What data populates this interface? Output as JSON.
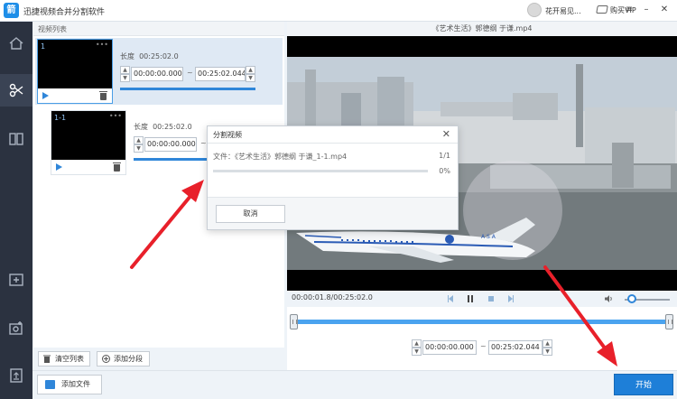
{
  "app": {
    "title": "迅捷视频合并分割软件",
    "logo_text": "箭",
    "username": "花开易见...",
    "vip_label": "购买VIP"
  },
  "sidebar": {
    "items": [
      {
        "icon": "home-icon",
        "active": false
      },
      {
        "icon": "scissors-icon",
        "active": true
      },
      {
        "icon": "merge-icon",
        "active": false
      },
      {
        "icon": "add-clip-icon",
        "active": false
      },
      {
        "icon": "media-settings-icon",
        "active": false
      },
      {
        "icon": "export-icon",
        "active": false
      }
    ]
  },
  "video_list": {
    "header": "视频列表",
    "clips": [
      {
        "label": "1",
        "length_label": "长度",
        "length": "00:25:02.0",
        "start": "00:00:00.000",
        "end": "00:25:02.044"
      },
      {
        "label": "1-1",
        "length_label": "长度",
        "length": "00:25:02.0",
        "start": "00:00:00.000",
        "end": ""
      }
    ],
    "tilde": "~",
    "clear_button": "清空列表",
    "add_segment_button": "添加分段"
  },
  "preview": {
    "title": "《艺术生活》郭德纲 于谦.mp4",
    "current_time": "00:00:01.8/00:25:02.0",
    "range_start": "00:00:00.000",
    "range_end": "00:25:02.044",
    "tilde": "~",
    "aircraft_text": "A S A",
    "volume": 0.1
  },
  "dialog": {
    "title": "分割视频",
    "file_line": "文件：《艺术生活》郭德纲 于谦_1-1.mp4",
    "count": "1/1",
    "percent": "0%",
    "progress": 0,
    "cancel_button": "取消"
  },
  "bottom": {
    "add_file_button": "添加文件",
    "start_button": "开始"
  },
  "colors": {
    "accent": "#2f86d9",
    "annotation_arrow": "#e8202a",
    "sidebar": "#2b3240"
  }
}
